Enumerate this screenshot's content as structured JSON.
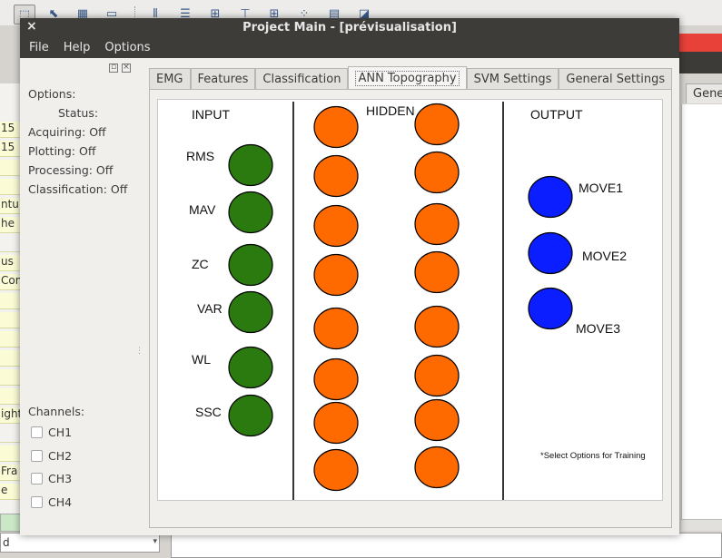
{
  "window": {
    "title": "Project Main - [prévisualisation]",
    "close_glyph": "×"
  },
  "menu": [
    "File",
    "Help",
    "Options"
  ],
  "dock": {
    "options_label": "Options:",
    "status_label": "Status:",
    "status_lines": [
      "Acquiring: Off",
      "Plotting: Off",
      "Processing: Off",
      "Classification: Off"
    ],
    "channels_label": "Channels:",
    "channels": [
      "CH1",
      "CH2",
      "CH3",
      "CH4"
    ]
  },
  "tabs": [
    "EMG",
    "Features",
    "Classification",
    "ANN Topography",
    "SVM Settings",
    "General Settings"
  ],
  "active_tab": "ANN Topography",
  "diagram": {
    "input_header": "INPUT",
    "hidden_header": "HIDDEN",
    "output_header": "OUTPUT",
    "inputs": [
      "RMS",
      "MAV",
      "ZC",
      "VAR",
      "WL",
      "SSC"
    ],
    "outputs": [
      "MOVE1",
      "MOVE2",
      "MOVE3"
    ],
    "hidden_per_column": 8,
    "hidden_columns": 2,
    "note": "*Select Options for Training",
    "colors": {
      "input_node": "#2a7a10",
      "hidden_node": "#ff6a00",
      "output_node": "#0a1eff"
    }
  },
  "background": {
    "left_cells": [
      "15",
      "15",
      "",
      "",
      "ntu",
      "he",
      "",
      "us",
      "Con",
      "",
      "",
      "",
      "",
      "",
      "",
      "ight",
      "",
      "",
      "Fra",
      "e"
    ],
    "right_tab": "Gene",
    "bottom_combo": "d",
    "toolbar_icons": [
      "select-icon",
      "cursor-icon",
      "chart-icon",
      "counter-icon",
      "bars-icon",
      "rows-icon",
      "columns-icon",
      "tree-icon",
      "grid-icon",
      "grid-small-icon",
      "folder-icon",
      "square-icon"
    ]
  }
}
